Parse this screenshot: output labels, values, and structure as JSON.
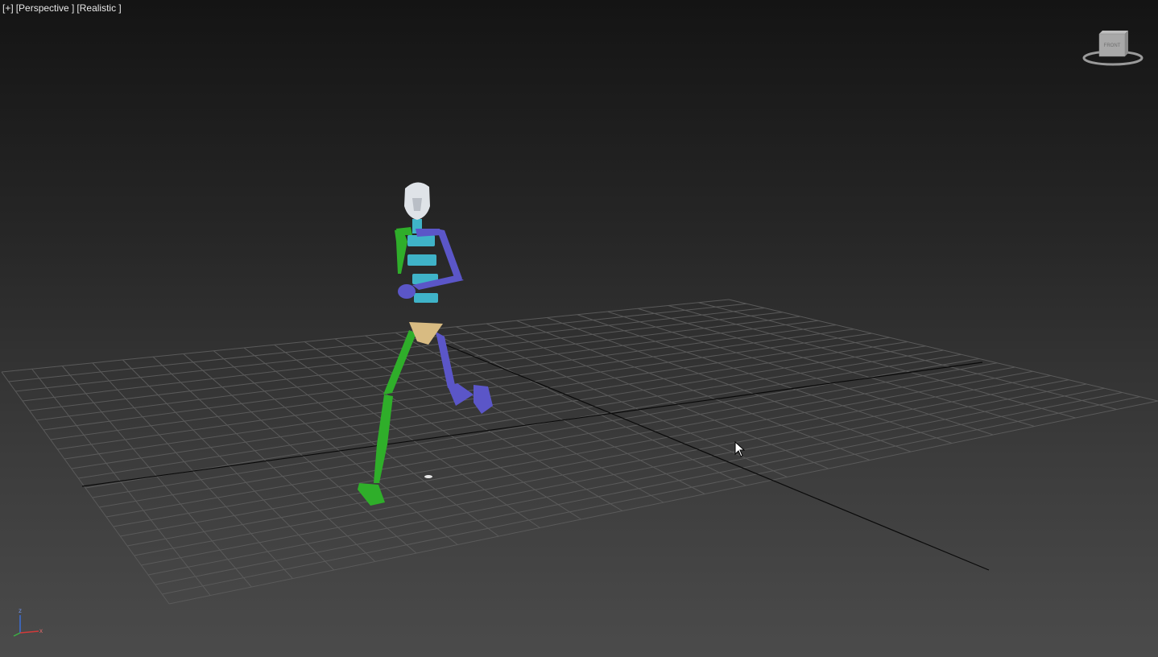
{
  "viewport": {
    "label_plus": "[+]",
    "label_view": "[Perspective ]",
    "label_shading": "[Realistic ]",
    "viewcube_face_label": "FRONT",
    "colors": {
      "grid_line": "#5a5a5a",
      "home_axis": "#0a0a0a",
      "left_side_bones": "#2fae2a",
      "right_side_bones": "#5b56c8",
      "spine_bones": "#3fb3c8",
      "pelvis": "#d8bb82",
      "head": "#dfe3e8"
    },
    "icons": {
      "viewcube": "viewcube-icon",
      "axis_tripod": "axis-tripod-icon",
      "cursor": "mouse-pointer-icon"
    },
    "axis_tripod": {
      "z_label": "z",
      "x_label": "x"
    }
  }
}
